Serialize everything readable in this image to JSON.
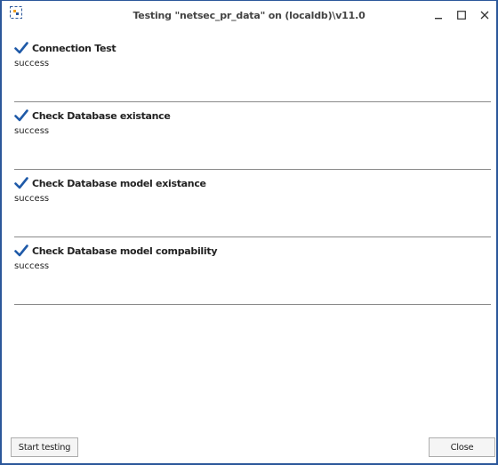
{
  "window": {
    "title": "Testing \"netsec_pr_data\" on (localdb)\\v11.0",
    "icon": "app-icon",
    "controls": [
      "minimize-icon",
      "maximize-icon",
      "close-icon"
    ]
  },
  "checks": [
    {
      "label": "Connection Test",
      "status": "success",
      "icon": "checkmark-icon"
    },
    {
      "label": "Check Database existance",
      "status": "success",
      "icon": "checkmark-icon"
    },
    {
      "label": "Check Database model existance",
      "status": "success",
      "icon": "checkmark-icon"
    },
    {
      "label": "Check Database model compability",
      "status": "success",
      "icon": "checkmark-icon"
    }
  ],
  "buttons": {
    "start": "Start testing",
    "close": "Close"
  },
  "colors": {
    "accent": "#2b579a",
    "check": "#1f5aa8"
  }
}
